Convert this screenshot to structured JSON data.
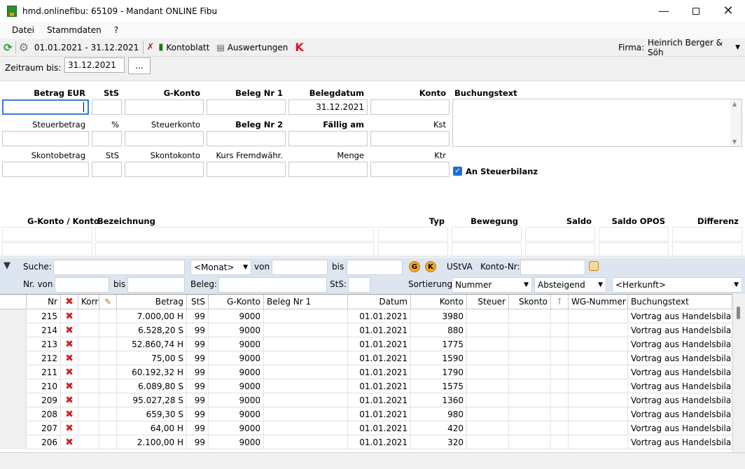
{
  "window": {
    "title": "hmd.onlinefibu: 65109 - Mandant ONLINE Fibu"
  },
  "menu": [
    "Datei",
    "Stammdaten",
    "?"
  ],
  "toolbar": {
    "period": "01.01.2021 - 31.12.2021",
    "kontoblatt": "Kontoblatt",
    "auswertungen": "Auswertungen",
    "k_label": "K",
    "firma_label": "Firma:",
    "firma_value": "Heinrich Berger & Söh"
  },
  "zeitraum": {
    "label": "Zeitraum bis:",
    "value": "31.12.2021",
    "button": "..."
  },
  "form": {
    "betrag": "Betrag EUR",
    "sts": "StS",
    "gkonto": "G-Konto",
    "belegnr1": "Beleg Nr 1",
    "belegdatum": "Belegdatum",
    "konto": "Konto",
    "buchungstext": "Buchungstext",
    "belegdatum_value": "31.12.2021",
    "steuerbetrag": "Steuerbetrag",
    "prozent": "%",
    "steuerkonto": "Steuerkonto",
    "belegnr2": "Beleg Nr 2",
    "faellig": "Fällig am",
    "kst": "Kst",
    "skontobetrag": "Skontobetrag",
    "sts2": "StS",
    "skontokonto": "Skontokonto",
    "kurs": "Kurs Fremdwähr.",
    "menge": "Menge",
    "ktr": "Ktr",
    "steuerbilanz": "An Steuerbilanz"
  },
  "kontoinfo": {
    "headers": [
      "G-Konto / Konto",
      "Bezeichnung",
      "Typ",
      "Bewegung",
      "Saldo",
      "Saldo OPOS",
      "Differenz"
    ]
  },
  "filter": {
    "suche": "Suche:",
    "monat": "<Monat>",
    "von": "von",
    "bis": "bis",
    "g": "G",
    "k": "K",
    "ustva": "UStVA",
    "kontonr": "Konto-Nr:",
    "nrvon": "Nr. von",
    "bis2": "bis",
    "beleg": "Beleg:",
    "sts": "StS:",
    "sortierung": "Sortierung:",
    "sort_value": "Nummer",
    "order_value": "Absteigend",
    "herkunft": "<Herkunft>"
  },
  "grid": {
    "headers": [
      "Nr",
      "",
      "Korr",
      "",
      "Betrag",
      "StS",
      "G-Konto",
      "Beleg Nr 1",
      "Datum",
      "Konto",
      "Steuer",
      "Skonto",
      "",
      "WG-Nummer",
      "Buchungstext"
    ],
    "rows": [
      {
        "nr": "215",
        "betrag": "7.000,00 H",
        "sts": "99",
        "gkonto": "9000",
        "datum": "01.01.2021",
        "konto": "3980",
        "text": "Vortrag aus Handelsbilanz"
      },
      {
        "nr": "214",
        "betrag": "6.528,20 S",
        "sts": "99",
        "gkonto": "9000",
        "datum": "01.01.2021",
        "konto": "880",
        "text": "Vortrag aus Handelsbilanz"
      },
      {
        "nr": "213",
        "betrag": "52.860,74 H",
        "sts": "99",
        "gkonto": "9000",
        "datum": "01.01.2021",
        "konto": "1775",
        "text": "Vortrag aus Handelsbilanz"
      },
      {
        "nr": "212",
        "betrag": "75,00 S",
        "sts": "99",
        "gkonto": "9000",
        "datum": "01.01.2021",
        "konto": "1590",
        "text": "Vortrag aus Handelsbilanz"
      },
      {
        "nr": "211",
        "betrag": "60.192,32 H",
        "sts": "99",
        "gkonto": "9000",
        "datum": "01.01.2021",
        "konto": "1790",
        "text": "Vortrag aus Handelsbilanz"
      },
      {
        "nr": "210",
        "betrag": "6.089,80 S",
        "sts": "99",
        "gkonto": "9000",
        "datum": "01.01.2021",
        "konto": "1575",
        "text": "Vortrag aus Handelsbilanz"
      },
      {
        "nr": "209",
        "betrag": "95.027,28 S",
        "sts": "99",
        "gkonto": "9000",
        "datum": "01.01.2021",
        "konto": "1360",
        "text": "Vortrag aus Handelsbilanz"
      },
      {
        "nr": "208",
        "betrag": "659,30 S",
        "sts": "99",
        "gkonto": "9000",
        "datum": "01.01.2021",
        "konto": "980",
        "text": "Vortrag aus Handelsbilanz"
      },
      {
        "nr": "207",
        "betrag": "64,00 H",
        "sts": "99",
        "gkonto": "9000",
        "datum": "01.01.2021",
        "konto": "420",
        "text": "Vortrag aus Handelsbilanz"
      },
      {
        "nr": "206",
        "betrag": "2.100,00 H",
        "sts": "99",
        "gkonto": "9000",
        "datum": "01.01.2021",
        "konto": "320",
        "text": "Vortrag aus Handelsbilanz"
      }
    ]
  }
}
